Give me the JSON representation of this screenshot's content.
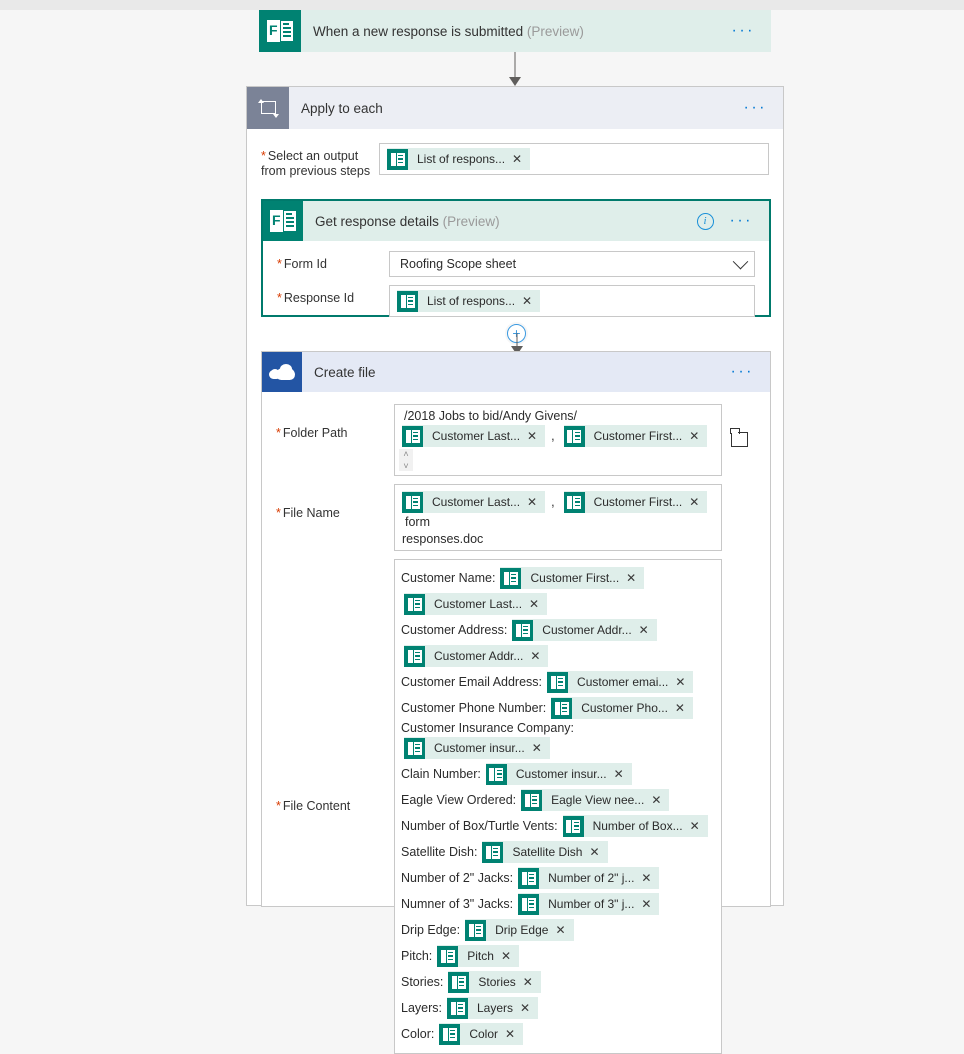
{
  "app": {
    "canvas_bg": "#f6f6f6",
    "accent_blue": "#0078d4",
    "forms_teal": "#008272",
    "onedrive_blue": "#2355a4",
    "chip_bg": "#dfeeea",
    "selected_border": "#007a6c"
  },
  "trigger": {
    "title": "When a new response is submitted",
    "preview": "(Preview)",
    "icon": "microsoft-forms-icon",
    "menu": "···"
  },
  "apply_to_each": {
    "title": "Apply to each",
    "icon": "loop-icon",
    "menu": "···",
    "output_label": "Select an output from previous steps",
    "output_label_line1": "Select an output",
    "output_label_line2": "from previous steps",
    "output_token": "List of respons...",
    "add_step": "+"
  },
  "get_response_details": {
    "title": "Get response details",
    "preview": "(Preview)",
    "icon": "microsoft-forms-icon",
    "info": "i",
    "menu": "···",
    "form_id_label": "Form Id",
    "form_id_value": "Roofing Scope sheet",
    "response_id_label": "Response Id",
    "response_id_token": "List of respons...",
    "add_step": "+"
  },
  "create_file": {
    "title": "Create file",
    "icon": "onedrive-cloud-icon",
    "menu": "···",
    "folder_path_label": "Folder Path",
    "folder_path_prefix": "/2018 Jobs to bid/Andy Givens/",
    "folder_path_tokens": [
      "Customer Last...",
      "Customer First..."
    ],
    "folder_path_separator": ",",
    "file_name_label": "File Name",
    "file_name_tokens": [
      "Customer Last...",
      "Customer First..."
    ],
    "file_name_separator": ",",
    "file_name_suffix": "form",
    "file_name_suffix2": "responses.doc",
    "file_content_label": "File Content",
    "file_content_lines": [
      {
        "label": "Customer Name:",
        "tokens": [
          "Customer First...",
          "Customer Last..."
        ]
      },
      {
        "label": "Customer Address:",
        "tokens": [
          "Customer Addr...",
          "Customer Addr..."
        ]
      },
      {
        "label": "Customer Email Address:",
        "tokens": [
          "Customer emai..."
        ]
      },
      {
        "label": "Customer Phone Number:",
        "tokens": [
          "Customer Pho..."
        ]
      },
      {
        "label": "Customer Insurance Company:",
        "tokens": [
          "Customer insur..."
        ]
      },
      {
        "label": "Clain Number:",
        "tokens": [
          "Customer insur..."
        ]
      },
      {
        "label": "Eagle View Ordered:",
        "tokens": [
          "Eagle View nee..."
        ]
      },
      {
        "label": "Number of Box/Turtle Vents:",
        "tokens": [
          "Number of Box..."
        ]
      },
      {
        "label": "Satellite Dish:",
        "tokens": [
          "Satellite Dish"
        ]
      },
      {
        "label": "Number of 2\" Jacks:",
        "tokens": [
          "Number of 2\" j..."
        ]
      },
      {
        "label": "Numner of 3\" Jacks:",
        "tokens": [
          "Number of 3\" j..."
        ]
      },
      {
        "label": "Drip Edge:",
        "tokens": [
          "Drip Edge"
        ]
      },
      {
        "label": "Pitch:",
        "tokens": [
          "Pitch"
        ]
      },
      {
        "label": "Stories:",
        "tokens": [
          "Stories"
        ]
      },
      {
        "label": "Layers:",
        "tokens": [
          "Layers"
        ]
      },
      {
        "label": "Color:",
        "tokens": [
          "Color"
        ]
      }
    ],
    "scrollbar_up": "˄",
    "scrollbar_down": "˅",
    "folder_picker_icon": "folder-icon"
  }
}
